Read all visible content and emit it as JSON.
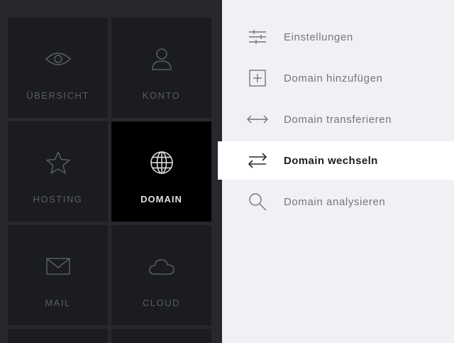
{
  "colors": {
    "grid_background": "#26282d",
    "tile_background": "#1b1c20",
    "tile_active_background": "#000000",
    "tile_text": "#5a5d64",
    "tile_active_text": "#dfe0e4",
    "menu_background": "#f0f1f5",
    "menu_active_background": "#ffffff",
    "menu_text": "#74767c",
    "menu_active_text": "#1b1c20"
  },
  "tiles": [
    {
      "label": "ÜBERSICHT",
      "icon": "eye-icon",
      "active": false
    },
    {
      "label": "KONTO",
      "icon": "user-icon",
      "active": false
    },
    {
      "label": "HOSTING",
      "icon": "star-icon",
      "active": false
    },
    {
      "label": "DOMAIN",
      "icon": "globe-icon",
      "active": true
    },
    {
      "label": "MAIL",
      "icon": "envelope-icon",
      "active": false
    },
    {
      "label": "CLOUD",
      "icon": "cloud-icon",
      "active": false
    }
  ],
  "menu": [
    {
      "label": "Einstellungen",
      "icon": "sliders-icon",
      "active": false
    },
    {
      "label": "Domain hinzufügen",
      "icon": "plus-box-icon",
      "active": false
    },
    {
      "label": "Domain transferieren",
      "icon": "double-arrow-icon",
      "active": false
    },
    {
      "label": "Domain wechseln",
      "icon": "swap-arrows-icon",
      "active": true
    },
    {
      "label": "Domain analysieren",
      "icon": "search-icon",
      "active": false
    }
  ]
}
